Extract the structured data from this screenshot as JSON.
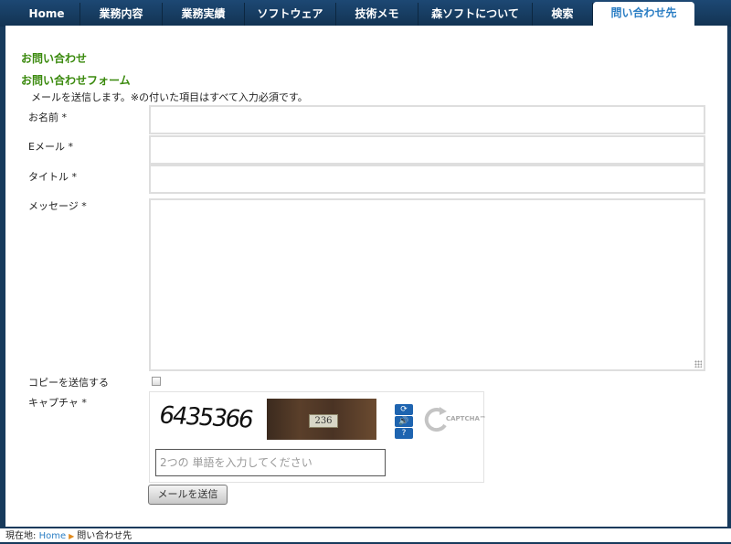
{
  "nav": {
    "tabs": [
      {
        "label": "Home"
      },
      {
        "label": "業務内容"
      },
      {
        "label": "業務実績"
      },
      {
        "label": "ソフトウェア"
      },
      {
        "label": "技術メモ"
      },
      {
        "label": "森ソフトについて"
      },
      {
        "label": "検索"
      },
      {
        "label": "問い合わせ先",
        "active": true
      }
    ]
  },
  "page": {
    "title": "お問い合わせ",
    "form_title": "お問い合わせフォーム",
    "intro": "メールを送信します。※の付いた項目はすべて入力必須です。"
  },
  "form": {
    "name_label": "お名前 *",
    "email_label": "Eメール *",
    "subject_label": "タイトル *",
    "message_label": "メッセージ *",
    "name_value": "",
    "email_value": "",
    "subject_value": "",
    "message_value": "",
    "copy_label": "コピーを送信する",
    "copy_checked": false,
    "captcha_label": "キャプチャ *",
    "captcha_word1": "6435366",
    "captcha_word2": "236",
    "captcha_placeholder": "2つの 単語を入力してください",
    "captcha_logo": "CAPTCHA™",
    "submit_label": "メールを送信"
  },
  "breadcrumb": {
    "prefix": "現在地:",
    "home": "Home",
    "current": "問い合わせ先"
  },
  "colors": {
    "nav_bg": "#173a5c",
    "heading_green": "#3b8a0e",
    "active_tab_text": "#2b7ec4",
    "captcha_button": "#1e64b0"
  }
}
